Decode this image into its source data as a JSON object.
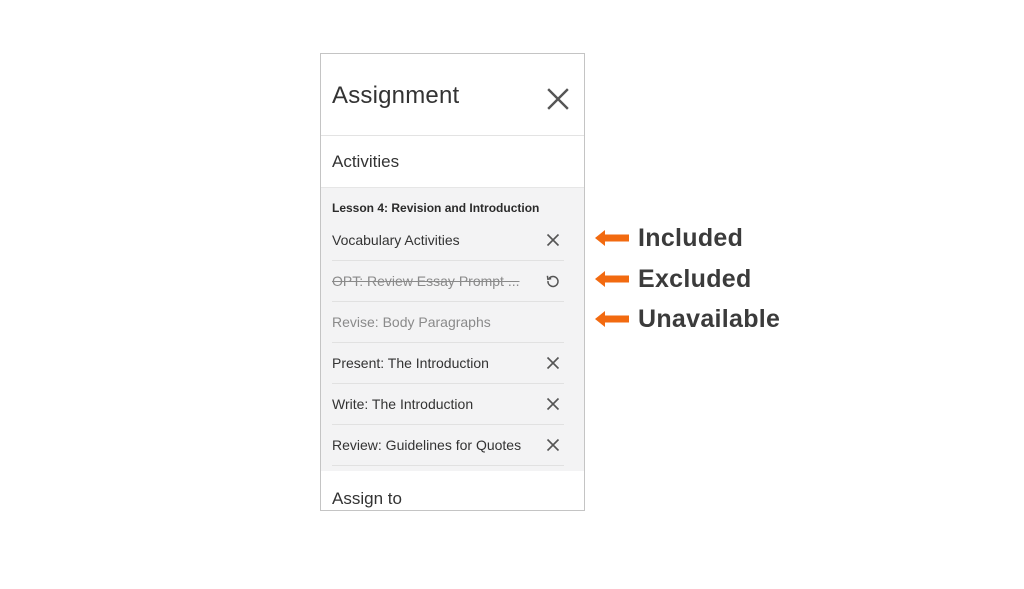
{
  "panel": {
    "title": "Assignment",
    "close_icon": "close-icon"
  },
  "activities": {
    "heading": "Activities",
    "lesson_title": "Lesson 4: Revision and Introduction",
    "items": [
      {
        "label": "Vocabulary Activities",
        "state": "included",
        "icon": "close-icon"
      },
      {
        "label": "OPT: Review Essay Prompt ...",
        "state": "excluded",
        "icon": "restore-icon"
      },
      {
        "label": "Revise: Body Paragraphs",
        "state": "unavailable",
        "icon": ""
      },
      {
        "label": "Present: The Introduction",
        "state": "included",
        "icon": "close-icon"
      },
      {
        "label": "Write: The Introduction",
        "state": "included",
        "icon": "close-icon"
      },
      {
        "label": "Review: Guidelines for Quotes",
        "state": "included",
        "icon": "close-icon"
      }
    ]
  },
  "assign_to": {
    "heading": "Assign to"
  },
  "callouts": [
    {
      "label": "Included",
      "icon": "arrow-left-icon"
    },
    {
      "label": "Excluded",
      "icon": "arrow-left-icon"
    },
    {
      "label": "Unavailable",
      "icon": "arrow-left-icon"
    }
  ],
  "colors": {
    "arrow": "#f26a10",
    "panel_border": "#c4c4c4",
    "activities_bg": "#f3f3f4"
  }
}
